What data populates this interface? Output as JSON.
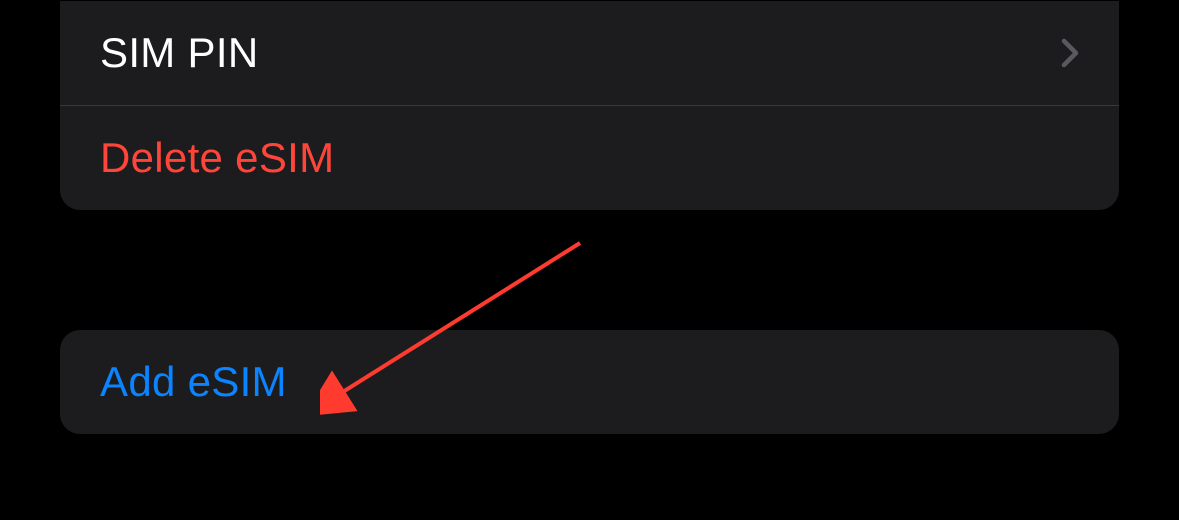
{
  "settings": {
    "sim_pin": {
      "label": "SIM PIN"
    },
    "delete_esim": {
      "label": "Delete eSIM"
    },
    "add_esim": {
      "label": "Add eSIM"
    }
  },
  "colors": {
    "destructive": "#ff453a",
    "link": "#0a84ff",
    "background": "#000000",
    "card": "#1c1c1e"
  }
}
